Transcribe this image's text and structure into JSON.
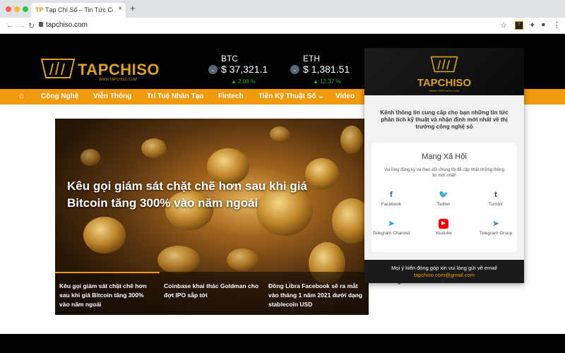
{
  "browser": {
    "tab_title": "Tạp Chí Số – Tin Tức Công Ngh",
    "tab_close": "×",
    "new_tab": "+",
    "url": "tapchiso.com",
    "back": "←",
    "forward": "→",
    "reload": "↻",
    "star": "☆",
    "ext_label": "T",
    "puzzle": "✦",
    "avatar": "●",
    "menu": "⋮",
    "traffic_colors": [
      "#ff5f57",
      "#febc2e",
      "#28c840"
    ]
  },
  "site": {
    "logo_text": "TAPCHISO",
    "logo_sub": "WWW.TAPCHISO.COM",
    "brand_color": "#d9a12a",
    "accent_color": "#f19a0e"
  },
  "tickers": [
    {
      "name": "BTC",
      "price": "$ 37,321.1",
      "change": "▲ 2.08 %",
      "icon": "dropdown-circle-icon"
    },
    {
      "name": "ETH",
      "price": "$ 1,381.51",
      "change": "▲ 12.37 %",
      "icon": "dropdown-circle-icon"
    }
  ],
  "nav": {
    "home_icon": "⌂",
    "items": [
      "Công Nghệ",
      "Viễn Thông",
      "Trí Tuệ Nhân Tạo",
      "Fintech",
      "Tiền Kỹ Thuật Số ⌄",
      "Video"
    ]
  },
  "hero": {
    "title": "Kêu gọi giám sát chặt chẽ hơn sau khi giá Bitcoin tăng 300% vào năm ngoái",
    "teasers": [
      "Kêu gọi giám sát chặt chẽ hơn sau khi giá Bitcoin tăng 300% vào năm ngoái",
      "Coinbase khai thác Goldman cho đợt IPO sắp tới",
      "Đồng Libra Facebook sẽ ra mắt vào tháng 1 năm 2021 dưới dạng stablecoin USD"
    ]
  },
  "behind_popup_text": "tháng 1 năm 2021",
  "popup": {
    "logo_text": "TAPCHISO",
    "logo_sub": "WWW.TAPCHISO.COM",
    "description": "Kênh thông tin cung cấp cho bạn những tin tức phân tích kỹ thuật và nhận định mới nhất về thị trường công nghệ số",
    "card_title": "Mạng Xã Hội",
    "card_subtitle": "Vui lòng đăng ký và theo dõi chúng tôi để cập nhật những thông tin mới nhất!",
    "socials": [
      {
        "label": "Facebook",
        "glyph": "f",
        "color": "#3b5998",
        "icon": "facebook-icon"
      },
      {
        "label": "Twitter",
        "glyph": "🐦",
        "color": "#1da1f2",
        "icon": "twitter-icon"
      },
      {
        "label": "Tumblr",
        "glyph": "t",
        "color": "#35465c",
        "icon": "tumblr-icon"
      },
      {
        "label": "Telegram Channel",
        "glyph": "➤",
        "color": "#2aa3df",
        "icon": "telegram-icon"
      },
      {
        "label": "Youtube",
        "glyph": "▶",
        "color": "#ff0000",
        "icon": "youtube-icon"
      },
      {
        "label": "Telegram Group",
        "glyph": "➤",
        "color": "#2aa3df",
        "icon": "telegram-icon"
      }
    ],
    "footer_line1": "Mọi ý kiến đóng góp xin vui lòng gửi về email",
    "footer_email": "tapchiso.com@gmail.com"
  }
}
